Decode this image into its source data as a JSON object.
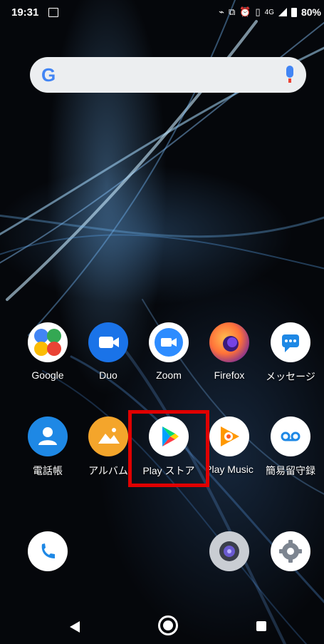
{
  "status_bar": {
    "time": "19:31",
    "network": "4G",
    "battery": "80%"
  },
  "search": {
    "logo": "G"
  },
  "apps_row1": [
    {
      "name": "google-app",
      "label": "Google"
    },
    {
      "name": "duo-app",
      "label": "Duo"
    },
    {
      "name": "zoom-app",
      "label": "Zoom"
    },
    {
      "name": "firefox-app",
      "label": "Firefox"
    },
    {
      "name": "messages-app",
      "label": "メッセージ"
    }
  ],
  "apps_row2": [
    {
      "name": "phonebook-app",
      "label": "電話帳"
    },
    {
      "name": "album-app",
      "label": "アルバム"
    },
    {
      "name": "play-store-app",
      "label": "Play ストア"
    },
    {
      "name": "play-music-app",
      "label": "Play Music"
    },
    {
      "name": "voicemail-app",
      "label": "簡易留守録"
    }
  ],
  "colors": {
    "highlight": "#e00000",
    "google_blue": "#4285f4",
    "duo_blue": "#1a73e8",
    "zoom_blue": "#2d8cff",
    "album_orange": "#f4a52b",
    "phone_blue": "#1e88e5"
  }
}
